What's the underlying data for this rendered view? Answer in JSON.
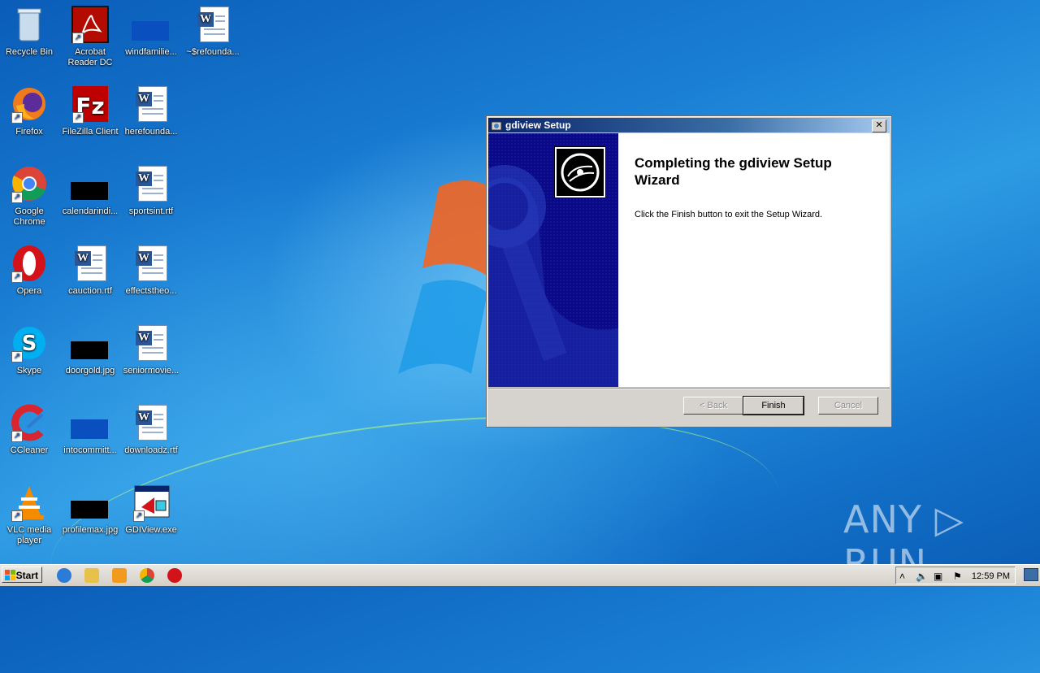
{
  "desktop": {
    "icons": [
      {
        "label": "Recycle Bin"
      },
      {
        "label": "Acrobat Reader DC"
      },
      {
        "label": "windfamilie..."
      },
      {
        "label": "~$refounda..."
      },
      {
        "label": "Firefox"
      },
      {
        "label": "FileZilla Client"
      },
      {
        "label": "herefounda..."
      },
      {
        "label": "Google Chrome"
      },
      {
        "label": "calendarindi..."
      },
      {
        "label": "sportsint.rtf"
      },
      {
        "label": "Opera"
      },
      {
        "label": "cauction.rtf"
      },
      {
        "label": "effectstheo..."
      },
      {
        "label": "Skype"
      },
      {
        "label": "doorgold.jpg"
      },
      {
        "label": "seniormovie..."
      },
      {
        "label": "CCleaner"
      },
      {
        "label": "intocommitt..."
      },
      {
        "label": "downloadz.rtf"
      },
      {
        "label": "VLC media player"
      },
      {
        "label": "profilemax.jpg"
      },
      {
        "label": "GDIView.exe"
      }
    ]
  },
  "dialog": {
    "title": "gdiview Setup",
    "close_label": "✕",
    "heading": "Completing the gdiview Setup Wizard",
    "body": "Click the Finish button to exit the Setup Wizard.",
    "buttons": {
      "back": "< Back",
      "finish": "Finish",
      "cancel": "Cancel"
    }
  },
  "watermark": {
    "text": "ANY ▷ RUN"
  },
  "taskbar": {
    "start_label": "Start",
    "clock": "12:59 PM",
    "pinned": [
      "ie-icon",
      "explorer-icon",
      "media-player-icon",
      "chrome-icon",
      "opera-icon"
    ]
  },
  "colors": {
    "desktop_blue": "#1a7fd4",
    "dialog_banner": "#0b0a86",
    "title_gradient_start": "#0a246a"
  }
}
